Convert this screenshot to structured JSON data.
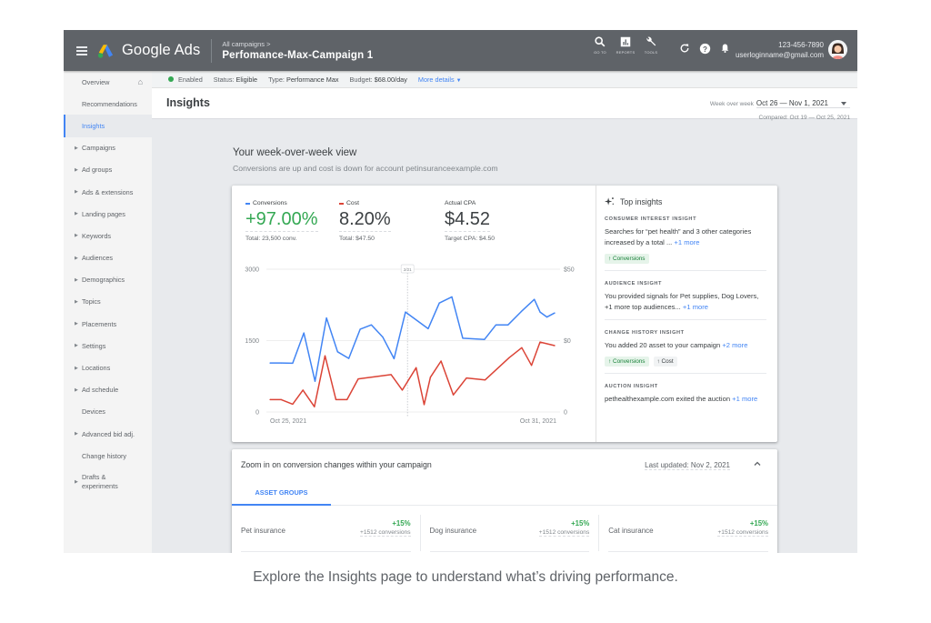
{
  "header": {
    "app_name": "Google Ads",
    "breadcrumb_parent": "All campaigns >",
    "campaign_name": "Perfomance-Max-Campaign 1",
    "icons": [
      {
        "name": "search-icon",
        "label": "GO TO"
      },
      {
        "name": "reports-icon",
        "label": "REPORTS"
      },
      {
        "name": "tools-icon",
        "label": "TOOLS"
      }
    ],
    "account_id": "123-456-7890",
    "account_email": "userloginname@gmail.com"
  },
  "sidebar": {
    "items": [
      {
        "label": "Overview",
        "expandable": false,
        "home": true
      },
      {
        "label": "Recommendations",
        "expandable": false
      },
      {
        "label": "Insights",
        "expandable": false,
        "active": true
      },
      {
        "label": "Campaigns",
        "expandable": true
      },
      {
        "label": "Ad groups",
        "expandable": true
      },
      {
        "label": "Ads & extensions",
        "expandable": true
      },
      {
        "label": "Landing pages",
        "expandable": true
      },
      {
        "label": "Keywords",
        "expandable": true
      },
      {
        "label": "Audiences",
        "expandable": true
      },
      {
        "label": "Demographics",
        "expandable": true
      },
      {
        "label": "Topics",
        "expandable": true
      },
      {
        "label": "Placements",
        "expandable": true
      },
      {
        "label": "Settings",
        "expandable": true
      },
      {
        "label": "Locations",
        "expandable": true
      },
      {
        "label": "Ad schedule",
        "expandable": true
      },
      {
        "label": "Devices",
        "expandable": false
      },
      {
        "label": "Advanced bid adj.",
        "expandable": true
      },
      {
        "label": "Change history",
        "expandable": false
      },
      {
        "label": "Drafts & experiments",
        "expandable": true
      }
    ]
  },
  "status_bar": {
    "enabled": "Enabled",
    "status_label": "Status:",
    "status_value": "Eligible",
    "type_label": "Type:",
    "type_value": "Performance Max",
    "budget_label": "Budget:",
    "budget_value": "$68.00/day",
    "more_details": "More details"
  },
  "page": {
    "title": "Insights",
    "date_mode": "Week over week",
    "date_range": "Oct 26 — Nov 1, 2021",
    "compared": "Compared: Oct 19 — Oct 25, 2021"
  },
  "overview": {
    "title": "Your week-over-week view",
    "subtitle": "Conversions are up and cost is down for account petinsuranceexample.com",
    "metrics": [
      {
        "label": "Conversions",
        "value": "+97.00%",
        "sub": "Total: 23,500 conv.",
        "color": "#4285f4",
        "value_color": "#34a853"
      },
      {
        "label": "Cost",
        "value": "8.20%",
        "sub": "Total: $47.50",
        "color": "#db4437",
        "value_color": "#3c4043"
      },
      {
        "label": "Actual CPA",
        "value": "$4.52",
        "sub": "Target CPA: $4.50",
        "color": null,
        "value_color": "#3c4043"
      }
    ]
  },
  "chart_data": {
    "type": "line",
    "title": "",
    "xlabel": "",
    "ylabel": "",
    "x_tick_labels": [
      "Oct 25, 2021",
      "Oct 31, 2021"
    ],
    "y_left_ticks": [
      "0",
      "1500",
      "3000"
    ],
    "y_right_ticks": [
      "0",
      "$0",
      "$50"
    ],
    "ylim": [
      0,
      3000
    ],
    "hover_marker_label": "2/21",
    "hover_marker_position": 0.48,
    "grid": true,
    "series": [
      {
        "name": "Conversions",
        "color": "#4285f4",
        "values": [
          1030,
          1030,
          1025,
          1660,
          645,
          1975,
          1265,
          1125,
          1740,
          1830,
          1570,
          1120,
          2100,
          1750,
          2290,
          2420,
          1550,
          1525,
          1830,
          1830,
          2110,
          2365,
          2100,
          1995,
          2080
        ]
      },
      {
        "name": "Cost",
        "color": "#db4437",
        "values": [
          260,
          260,
          165,
          460,
          110,
          1180,
          260,
          260,
          695,
          785,
          460,
          930,
          155,
          730,
          1070,
          360,
          715,
          675,
          1140,
          1350,
          980,
          1470,
          1395
        ]
      }
    ],
    "series_x_fractions": {
      "Conversions": [
        0.0,
        0.039,
        0.079,
        0.118,
        0.157,
        0.197,
        0.236,
        0.275,
        0.315,
        0.354,
        0.394,
        0.433,
        0.473,
        0.552,
        0.591,
        0.635,
        0.673,
        0.749,
        0.789,
        0.831,
        0.877,
        0.923,
        0.943,
        0.967,
        0.994
      ],
      "Cost": [
        0.0,
        0.039,
        0.079,
        0.115,
        0.155,
        0.192,
        0.23,
        0.269,
        0.308,
        0.423,
        0.462,
        0.51,
        0.538,
        0.56,
        0.597,
        0.64,
        0.686,
        0.751,
        0.835,
        0.879,
        0.913,
        0.943,
        0.994
      ]
    }
  },
  "top_insights": {
    "title": "Top insights",
    "items": [
      {
        "kicker": "CONSUMER INTEREST INSIGHT",
        "text": "Searches for “pet health” and 3 other categories increased by a total ...",
        "more": "+1 more",
        "chips": [
          {
            "label": "Conversions",
            "style": "green"
          }
        ]
      },
      {
        "kicker": "AUDIENCE INSIGHT",
        "text": "You provided signals for Pet supplies, Dog Lovers, +1 more top audiences...",
        "more": "+1 more",
        "chips": []
      },
      {
        "kicker": "CHANGE HISTORY INSIGHT",
        "text": "You added 20 asset to your campaign",
        "more": "+2 more",
        "chips": [
          {
            "label": "Conversions",
            "style": "green"
          },
          {
            "label": "Cost",
            "style": "grey"
          }
        ]
      },
      {
        "kicker": "AUCTION INSIGHT",
        "text": "pethealthexample.com exited the auction",
        "more": "+1 more",
        "chips": []
      }
    ]
  },
  "zoom_section": {
    "title": "Zoom in on conversion changes within your campaign",
    "last_updated": "Last updated: Nov 2, 2021",
    "tab": "ASSET GROUPS",
    "groups": [
      {
        "name": "Pet insurance",
        "change": "+15%",
        "conversions": "+1512 conversions"
      },
      {
        "name": "Dog insurance",
        "change": "+15%",
        "conversions": "+1512 conversions"
      },
      {
        "name": "Cat insurance",
        "change": "+15%",
        "conversions": "+1512 conversions"
      }
    ]
  },
  "caption": "Explore the Insights page to understand what’s driving performance."
}
